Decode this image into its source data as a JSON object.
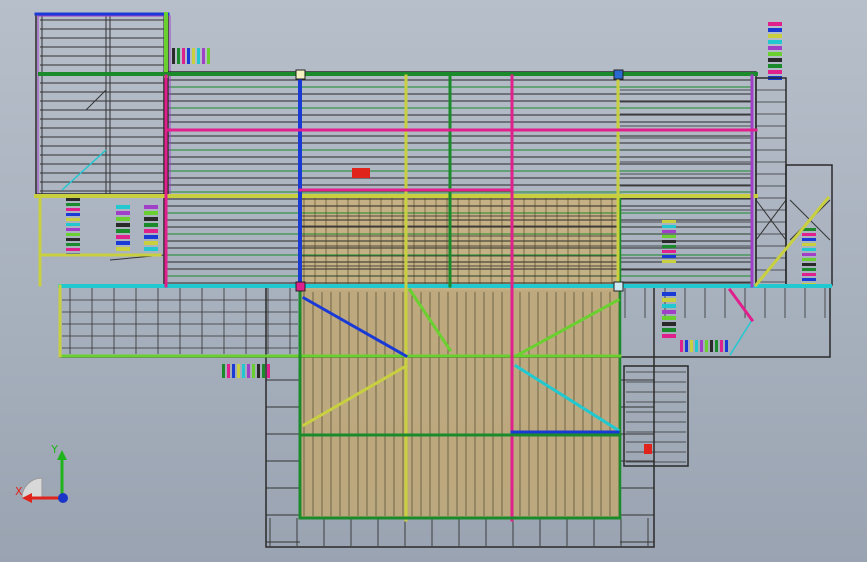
{
  "viewport": {
    "background_top": "#b7bfca",
    "background_bottom": "#9aa3b1"
  },
  "triad": {
    "x_label": "X",
    "y_label": "Y",
    "x_color": "#e0231b",
    "y_color": "#1fb41c",
    "z_color": "#1a36c8"
  },
  "model": {
    "palette": [
      "#2a2a2a",
      "#1a8a2a",
      "#e0208c",
      "#1a3ad6",
      "#c8d040",
      "#22c8d0",
      "#a040c8",
      "#6ad030"
    ],
    "fill_color": "#c9b07a"
  }
}
